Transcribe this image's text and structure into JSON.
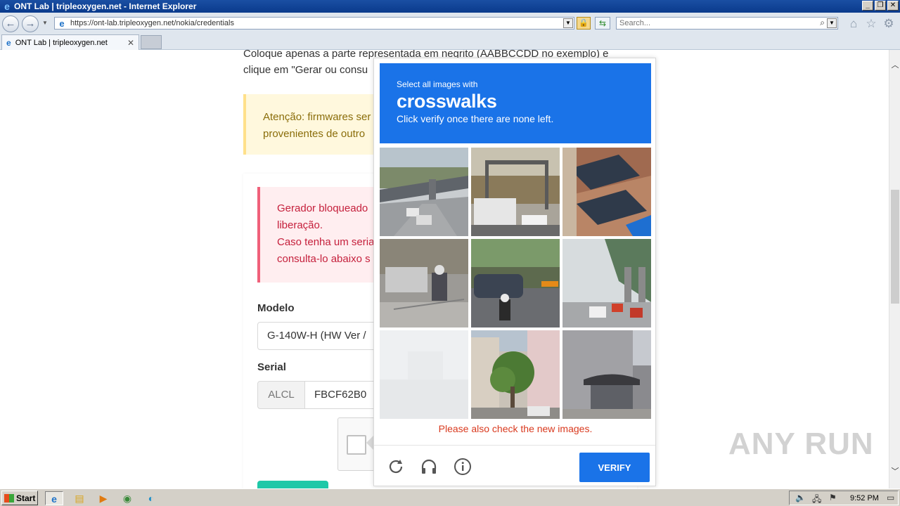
{
  "window": {
    "title": "ONT Lab | tripleoxygen.net - Internet Explorer",
    "buttons": [
      "_",
      "❐",
      "✕"
    ]
  },
  "browser": {
    "url": "https://ont-lab.tripleoxygen.net/nokia/credentials",
    "search_placeholder": "Search...",
    "tab_label": "ONT Lab | tripleoxygen.net"
  },
  "page": {
    "intro_line1": "Coloque apenas a parte representada em negrito (AABBCCDD no exemplo) e",
    "intro_line2": "clique em \"Gerar ou consu",
    "warning_line1": "Atenção: firmwares ser",
    "warning_line2": "provenientes de outro",
    "danger_line1": "Gerador bloqueado",
    "danger_line2": "liberação.",
    "danger_line3": "Caso tenha um seria",
    "danger_line4": "consulta-lo abaixo s",
    "model_label": "Modelo",
    "model_value": "G-140W-H (HW Ver /",
    "serial_label": "Serial",
    "serial_prefix": "ALCL",
    "serial_value": "FBCF62B0"
  },
  "captcha": {
    "instruction_small": "Select all images with",
    "target": "crosswalks",
    "instruction_sub": "Click verify once there are none left.",
    "error_message": "Please also check the new images.",
    "verify_label": "VERIFY",
    "icons": [
      "refresh-icon",
      "audio-challenge-icon",
      "info-icon"
    ],
    "tiles": [
      "overpass-highway",
      "traffic-gantry-vans",
      "balcony-building",
      "street-motorcycle",
      "intersection-car-motorbike",
      "elevated-rail-street",
      "faded-blank",
      "tree-buildings-street",
      "bus-stop-building"
    ],
    "colors": {
      "header": "#1a73e8",
      "error": "#d9391e"
    }
  },
  "watermark": "ANY RUN",
  "taskbar": {
    "start_label": "Start",
    "clock": "9:52 PM"
  }
}
